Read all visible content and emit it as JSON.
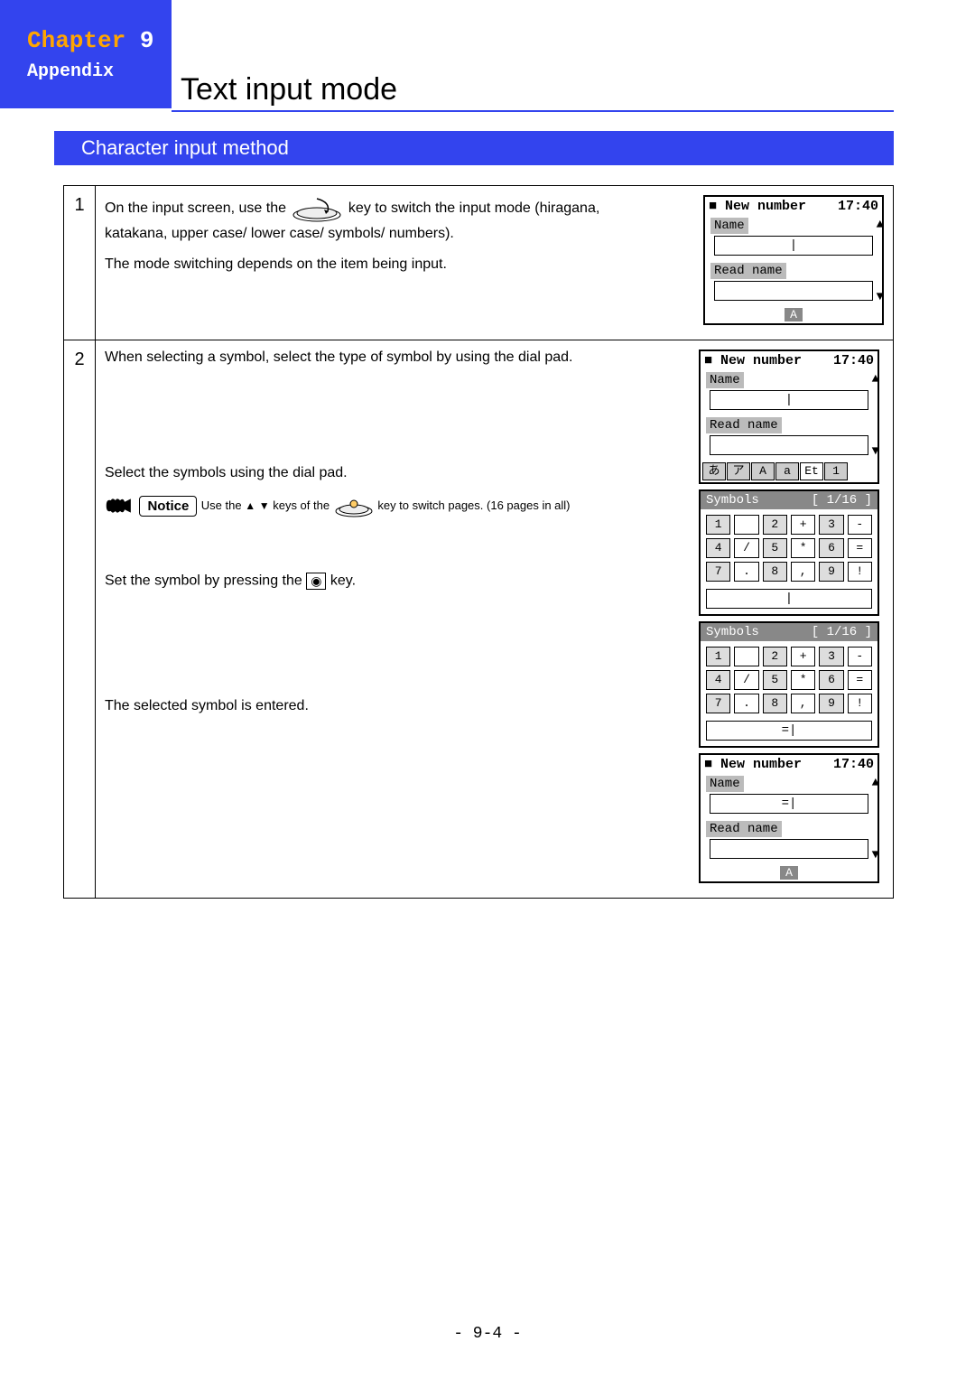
{
  "header": {
    "chapter_word": "Chapter",
    "chapter_num": "9",
    "appendix": "Appendix",
    "title": "Text input mode"
  },
  "section": {
    "heading": "Character input method"
  },
  "steps": {
    "step1": {
      "num": "1",
      "line1a": "On the input screen, use the",
      "line1b": "key to switch the input mode (hiragana,",
      "line2": "katakana, upper case/ lower case/ symbols/ numbers).",
      "line3": "The mode switching depends on the item being input."
    },
    "step2": {
      "num": "2",
      "p1": "When selecting a symbol, select the type of symbol by using the dial pad.",
      "p2": "Select the symbols using the dial pad.",
      "notice_label": "Notice",
      "notice_a": "Use the",
      "notice_b": "keys of the",
      "notice_c": "key to switch pages. (16 pages in all)",
      "p3a": "Set the symbol by pressing the",
      "p3b": "key.",
      "center_key_glyph": "◉",
      "p4": "The selected symbol is entered."
    }
  },
  "phone": {
    "title": "New number",
    "time": "17:40",
    "name_label": "Name",
    "read_label": "Read name",
    "mode_A": "A",
    "cursor": "|",
    "entered": "=|",
    "tabs": [
      "あ",
      "ア",
      "A",
      "a",
      "Et",
      "1"
    ]
  },
  "symbols": {
    "header": "Symbols",
    "page": "[ 1/16 ]",
    "cells": [
      "1",
      " ",
      "2",
      "+",
      "3",
      "-",
      "4",
      "/",
      "5",
      "*",
      "6",
      "=",
      "7",
      ".",
      "8",
      ",",
      "9",
      "!"
    ],
    "cursor": "|",
    "entered": "=|"
  },
  "footer": {
    "page": "- 9-4 -"
  }
}
